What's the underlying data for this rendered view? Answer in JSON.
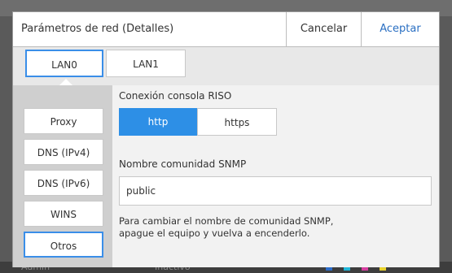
{
  "background": {
    "user": "Admin",
    "status": "Inactivo",
    "toner_colors": [
      "#2c6cc9",
      "#21b6d8",
      "#d63fa0",
      "#e8d22c"
    ]
  },
  "dialog": {
    "title": "Parámetros de red (Detalles)",
    "cancel_label": "Cancelar",
    "accept_label": "Aceptar",
    "tabs": [
      {
        "label": "LAN0",
        "selected": true
      },
      {
        "label": "LAN1",
        "selected": false
      }
    ],
    "menu": [
      {
        "label": "Proxy",
        "selected": false
      },
      {
        "label": "DNS (IPv4)",
        "selected": false
      },
      {
        "label": "DNS (IPv6)",
        "selected": false
      },
      {
        "label": "WINS",
        "selected": false
      },
      {
        "label": "Otros",
        "selected": true
      }
    ],
    "riso_console": {
      "label": "Conexión consola RISO",
      "options": [
        "http",
        "https"
      ],
      "selected": "http"
    },
    "snmp": {
      "label": "Nombre comunidad SNMP",
      "value": "public",
      "note": "Para cambiar el nombre de comunidad SNMP,\napague el equipo y vuelva a encenderlo."
    }
  },
  "colors": {
    "accent": "#2d8fe6",
    "accept_text": "#2a6fc2"
  }
}
